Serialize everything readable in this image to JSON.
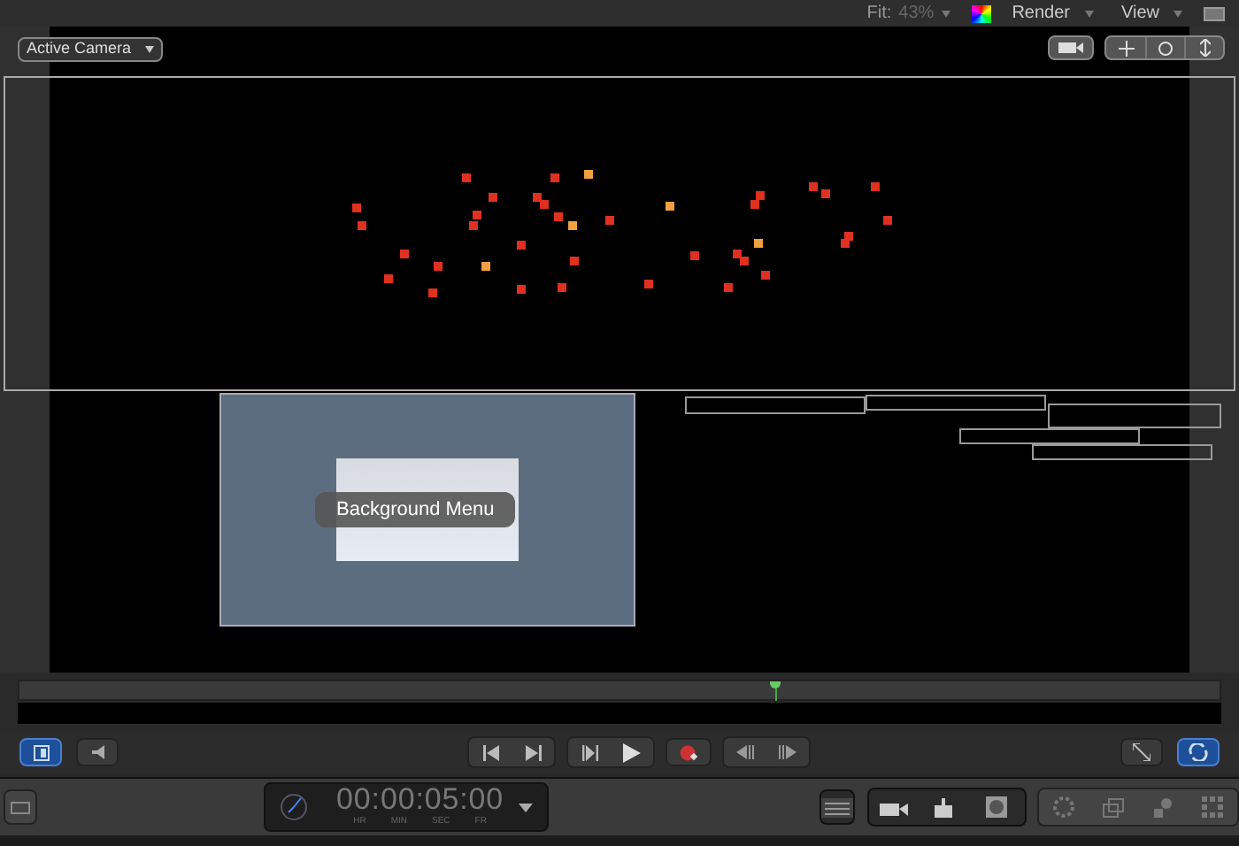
{
  "top_bar": {
    "fit_label": "Fit:",
    "fit_value": "43%",
    "menus": [
      "Render",
      "View"
    ]
  },
  "canvas": {
    "camera_menu": "Active Camera",
    "object_label": "Background Menu"
  },
  "timeline": {
    "playhead": {
      "level": 0.63
    }
  },
  "transport": {
    "layout_toggle": {
      "on": true
    },
    "loop": {
      "on": true
    }
  },
  "timecode": {
    "value": "00:00:05:00",
    "units": [
      "HR",
      "MIN",
      "SEC",
      "FR"
    ]
  }
}
